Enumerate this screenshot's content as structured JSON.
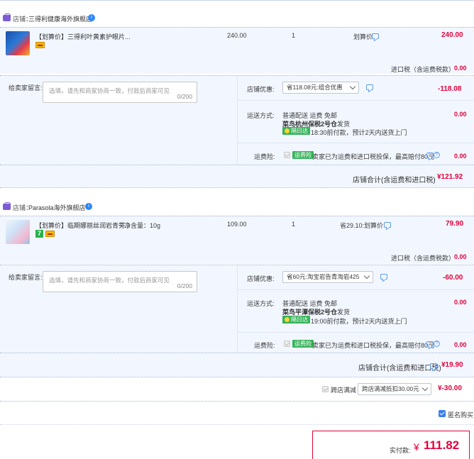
{
  "colors": {
    "accent_red": "#e4003a",
    "link_blue": "#2f86f6",
    "panel_bg": "#f2f7ff",
    "green_tag": "#36b35a"
  },
  "shops": [
    {
      "shop_label": "店铺：",
      "name": "三得利健康海外旗舰店",
      "item": {
        "title": "【划算价】三得利叶黄素护眼片...",
        "unit_price": "240.00",
        "quantity": "1",
        "discount": "划算价",
        "subtotal": "240.00"
      },
      "import_tax_label": "进口税（含运费税款）",
      "import_tax_value": "0.00",
      "message_label": "给卖家留言:",
      "message_placeholder": "选填，请先和商家协商一致，付款后商家可见",
      "message_count": "0/200",
      "promo_label": "店铺优惠:",
      "promo_selected": "省118.08元:组合优惠",
      "promo_value": "-118.08",
      "shipping_label": "运送方式:",
      "shipping_line1": "普通配送 运费 免邮",
      "shipping_warehouse": "菜鸟杭州保税2号仓",
      "shipping_send": "发货",
      "shipping_tag": "隔日达",
      "shipping_eta": "18:30前付款，预计2天内送货上门",
      "shipping_value": "0.00",
      "insurance_label": "运费险:",
      "insurance_tag": "运费险",
      "insurance_desc": "卖家已为运费和进口税投保，最高赔付80元",
      "insurance_value": "0.00",
      "total_label": "店铺合计(含运费和进口税)",
      "total_value": "¥121.92"
    },
    {
      "shop_label": "店铺：",
      "name": "Parasola海外旗舰店",
      "item": {
        "title": "【划算价】临期娜丽丝润岩青蒡...",
        "spec": "净含量：10g",
        "unit_price": "109.00",
        "quantity": "1",
        "discount": "省29.10:划算价",
        "subtotal": "79.90"
      },
      "import_tax_label": "进口税（含运费税款）",
      "import_tax_value": "0.00",
      "message_label": "给卖家留言:",
      "message_placeholder": "选填，请先和商家协商一致，付款后商家可见",
      "message_count": "0/200",
      "promo_label": "店铺优惠:",
      "promo_selected": "省60元:淘宝岩告青淘岩425",
      "promo_value": "-60.00",
      "shipping_label": "运送方式:",
      "shipping_line1": "普通配送 运费 免邮",
      "shipping_warehouse": "菜鸟平潭保税2号仓",
      "shipping_send": "发货",
      "shipping_tag": "隔日达",
      "shipping_eta": "19:00前付款，预计2天内送货上门",
      "shipping_value": "0.00",
      "insurance_label": "运费险:",
      "insurance_tag": "运费险",
      "insurance_desc": "卖家已为运费和进口税投保，最高赔付80元",
      "insurance_value": "0.00",
      "total_label": "店铺合计(含运费和进口税)",
      "total_value": "¥19.90"
    }
  ],
  "cross_store": {
    "label": "跨店满减",
    "selected": "跨店满减抵扣30.00元",
    "value": "¥-30.00"
  },
  "anonymous_label": "匿名购买",
  "payment": {
    "label": "实付款:",
    "currency": "¥",
    "amount": "111.82"
  }
}
